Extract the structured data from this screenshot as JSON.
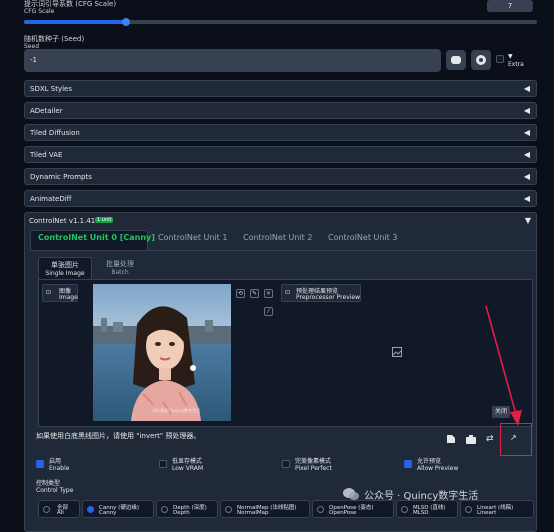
{
  "cfg": {
    "label_cn": "提示词引导系数 (CFG Scale)",
    "label_en": "CFG Scale",
    "value": "7",
    "fraction": 0.2
  },
  "seed": {
    "label_cn": "随机数种子 (Seed)",
    "label_en": "Seed",
    "value": "-1",
    "extra": "Extra"
  },
  "panels": [
    "SDXL Styles",
    "ADetailer",
    "Tiled Diffusion",
    "Tiled VAE",
    "Dynamic Prompts",
    "AnimateDiff"
  ],
  "controlnet": {
    "title": "ControlNet v1.1.411",
    "badge": "1 unit",
    "tabs": [
      "ControlNet Unit 0 [Canny]",
      "ControlNet Unit 1",
      "ControlNet Unit 2",
      "ControlNet Unit 3"
    ],
    "subtabs": [
      {
        "cn": "单张图片",
        "en": "Single Image"
      },
      {
        "cn": "批量处理",
        "en": "Batch"
      }
    ],
    "image_label": {
      "cn": "图像",
      "en": "Image"
    },
    "preview_label": {
      "cn": "预处理结果预览",
      "en": "Preprocessor Preview"
    },
    "close_label": "关闭",
    "watermark": "AI小姐姐 Quincy数字生活",
    "hint": "如果使用白底黑线图片，请使用 \"invert\" 预处理器。",
    "checkboxes": [
      {
        "cn": "启用",
        "en": "Enable",
        "checked": true
      },
      {
        "cn": "低显存模式",
        "en": "Low VRAM",
        "checked": false
      },
      {
        "cn": "完美像素模式",
        "en": "Pixel Perfect",
        "checked": false
      },
      {
        "cn": "允许预览",
        "en": "Allow Preview",
        "checked": true
      }
    ],
    "control_type": {
      "cn": "控制类型",
      "en": "Control Type"
    },
    "types": [
      {
        "cn": "全部",
        "en": "All",
        "selected": false
      },
      {
        "cn": "Canny (硬边缘)",
        "en": "Canny",
        "selected": true
      },
      {
        "cn": "Depth (深度)",
        "en": "Depth",
        "selected": false
      },
      {
        "cn": "NormalMap (法线贴图)",
        "en": "NormalMap",
        "selected": false
      },
      {
        "cn": "OpenPose (姿态)",
        "en": "OpenPose",
        "selected": false
      },
      {
        "cn": "MLSD (直线)",
        "en": "MLSD",
        "selected": false
      },
      {
        "cn": "Lineart (线稿)",
        "en": "Lineart",
        "selected": false
      }
    ]
  },
  "watermark_overlay": "公众号 · Quincy数字生活",
  "colors": {
    "accent": "#2563eb",
    "badge": "#16a34a",
    "active_tab": "#22c55e",
    "annotation": "#e11d48"
  }
}
